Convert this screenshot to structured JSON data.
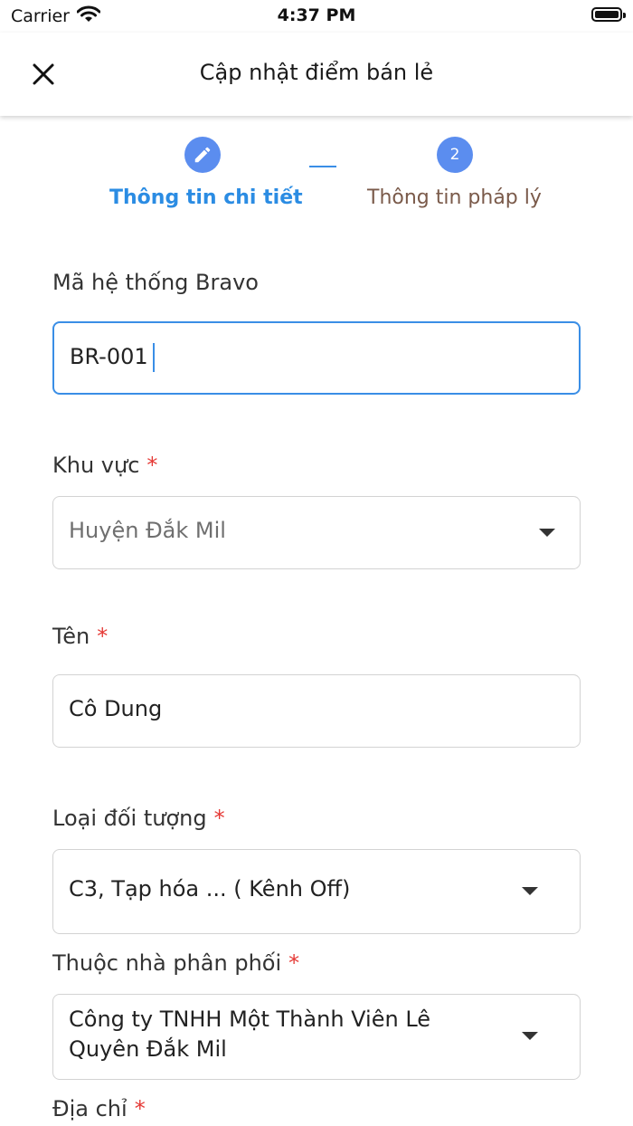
{
  "status_bar": {
    "carrier": "Carrier",
    "time": "4:37 PM"
  },
  "header": {
    "title": "Cập nhật điểm bán lẻ"
  },
  "stepper": {
    "step2_number": "2",
    "step1_label": "Thông tin chi tiết",
    "step2_label": "Thông tin pháp lý"
  },
  "form": {
    "bravo_code": {
      "label": "Mã hệ thống Bravo",
      "value": "BR-001"
    },
    "region": {
      "label": "Khu vực",
      "required": "*",
      "value": "Huyện Đắk Mil"
    },
    "name": {
      "label": "Tên",
      "required": "*",
      "value": "Cô Dung"
    },
    "object_type": {
      "label": "Loại đối tượng",
      "required": "*",
      "value": "C3, Tạp hóa ... ( Kênh Off)"
    },
    "distributor": {
      "label": "Thuộc nhà phân phối",
      "required": "*",
      "value_line1": "Công ty TNHH Một Thành Viên Lê",
      "value_line2": "Quyên Đắk Mil"
    },
    "address": {
      "label": "Địa chỉ",
      "required": "*"
    }
  },
  "colors": {
    "accent": "#3a8ee6",
    "step_circle": "#5b8def",
    "required": "#e53935"
  }
}
